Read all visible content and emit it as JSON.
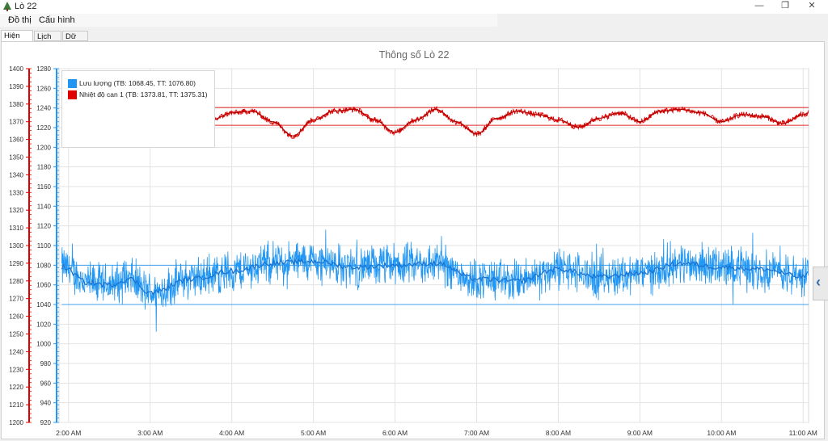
{
  "window": {
    "title": "Lò 22",
    "minimize_icon": "minimize-icon",
    "maximize_icon": "restore-icon",
    "close_icon": "close-icon"
  },
  "menu": [
    {
      "label": "Đồ thị"
    },
    {
      "label": "Cấu hình"
    }
  ],
  "tabs": [
    {
      "label": "Hiện thời",
      "active": true
    },
    {
      "label": "Lịch sử"
    },
    {
      "label": "Dữ liệu"
    }
  ],
  "chart": {
    "title": "Thông số Lò 22",
    "left_axis_labels": [
      "1400",
      "1390",
      "1380",
      "1370",
      "1360",
      "1350",
      "1340",
      "1330",
      "1320",
      "1310",
      "1300",
      "1290",
      "1280",
      "1270",
      "1260",
      "1250",
      "1240",
      "1230",
      "1220",
      "1210",
      "1200"
    ],
    "right_axis_labels": [
      "1280",
      "1260",
      "1240",
      "1220",
      "1200",
      "1180",
      "1160",
      "1140",
      "1120",
      "1100",
      "1080",
      "1060",
      "1040",
      "1020",
      "1000",
      "980",
      "960",
      "940",
      "920"
    ],
    "x_labels": [
      "2:00 AM",
      "3:00 AM",
      "4:00 AM",
      "5:00 AM",
      "6:00 AM",
      "7:00 AM",
      "8:00 AM",
      "9:00 AM",
      "10:00 AM",
      "11:00 AM"
    ],
    "legend": [
      {
        "label": "Lưu lượng (TB: 1068.45, TT: 1076.80)",
        "color": "#2196f3"
      },
      {
        "label": "Nhiệt độ can 1 (TB: 1373.81, TT: 1375.31)",
        "color": "#e00000"
      }
    ]
  },
  "chart_data": {
    "type": "line",
    "title": "Thông số Lò 22",
    "x_range": [
      "1:53 AM",
      "11:04 AM"
    ],
    "left_axis": {
      "range": [
        1200,
        1400
      ],
      "color": "#e00000"
    },
    "right_axis": {
      "range": [
        920,
        1280
      ],
      "color": "#2196f3"
    },
    "grid": true,
    "legend_position": "top-left",
    "series": [
      {
        "name": "Lưu lượng (TB: 1068.45, TT: 1076.80)",
        "color": "#2196f3",
        "axis": "right",
        "mean": 1068.45,
        "current": 1076.8,
        "limits": [
          1040,
          1080
        ],
        "x": [
          "1:55 AM",
          "2:15 AM",
          "2:30 AM",
          "2:45 AM",
          "3:00 AM",
          "3:30 AM",
          "4:00 AM",
          "4:30 AM",
          "5:00 AM",
          "5:30 AM",
          "6:00 AM",
          "6:30 AM",
          "7:00 AM",
          "7:30 AM",
          "8:00 AM",
          "8:30 AM",
          "9:00 AM",
          "9:30 AM",
          "10:00 AM",
          "10:30 AM",
          "11:00 AM",
          "11:04 AM"
        ],
        "values": [
          1078,
          1062,
          1060,
          1066,
          1052,
          1066,
          1074,
          1082,
          1084,
          1078,
          1080,
          1082,
          1066,
          1064,
          1076,
          1068,
          1072,
          1082,
          1078,
          1076,
          1068,
          1074
        ]
      },
      {
        "name": "Nhiệt độ can 1 (TB: 1373.81, TT: 1375.31)",
        "color": "#e00000",
        "axis": "left",
        "mean": 1373.81,
        "current": 1375.31,
        "limits": [
          1368,
          1378
        ],
        "x": [
          "3:30 AM",
          "3:45 AM",
          "4:00 AM",
          "4:15 AM",
          "4:30 AM",
          "4:45 AM",
          "5:00 AM",
          "5:15 AM",
          "5:30 AM",
          "5:45 AM",
          "6:00 AM",
          "6:15 AM",
          "6:30 AM",
          "6:45 AM",
          "7:00 AM",
          "7:15 AM",
          "7:30 AM",
          "7:45 AM",
          "8:00 AM",
          "8:15 AM",
          "8:30 AM",
          "8:45 AM",
          "9:00 AM",
          "9:15 AM",
          "9:30 AM",
          "9:45 AM",
          "10:00 AM",
          "10:15 AM",
          "10:30 AM",
          "10:45 AM",
          "11:00 AM",
          "11:04 AM"
        ],
        "values": [
          1376,
          1371,
          1375,
          1376,
          1370,
          1362,
          1371,
          1376,
          1377,
          1371,
          1364,
          1371,
          1377,
          1370,
          1363,
          1372,
          1376,
          1374,
          1371,
          1367,
          1372,
          1375,
          1370,
          1376,
          1377,
          1375,
          1370,
          1374,
          1373,
          1369,
          1374,
          1375
        ]
      }
    ]
  }
}
